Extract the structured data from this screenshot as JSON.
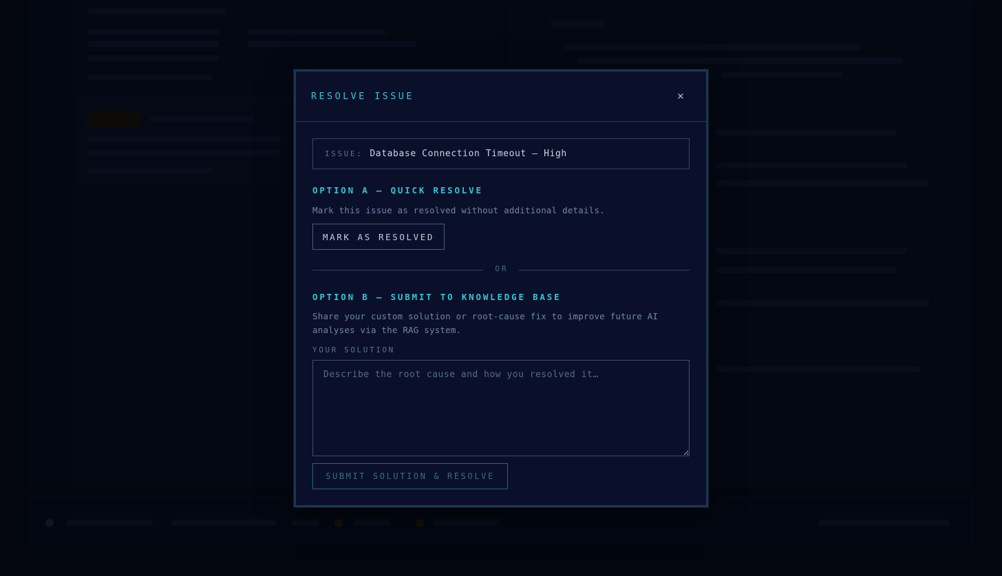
{
  "modal": {
    "title": "RESOLVE ISSUE",
    "close_glyph": "×",
    "issue": {
      "label": "ISSUE:",
      "value": "Database Connection Timeout — High"
    },
    "option_a": {
      "title": "OPTION A — QUICK RESOLVE",
      "description": "Mark this issue as resolved without additional details.",
      "button_label": "MARK AS RESOLVED"
    },
    "divider_label": "OR",
    "option_b": {
      "title": "OPTION B — SUBMIT TO KNOWLEDGE BASE",
      "description": "Share your custom solution or root-cause fix to improve future AI analyses via the RAG system.",
      "field_label": "YOUR SOLUTION",
      "textarea_value": "",
      "textarea_placeholder": "Describe the root cause and how you resolved it…",
      "submit_label": "SUBMIT SOLUTION & RESOLVE",
      "submit_disabled": true
    }
  },
  "colors": {
    "accent": "#35c3d6",
    "modal_bg": "#0a1029",
    "page_bg": "#03060f",
    "border": "#33466a"
  },
  "icons": {
    "close": "close-icon"
  }
}
